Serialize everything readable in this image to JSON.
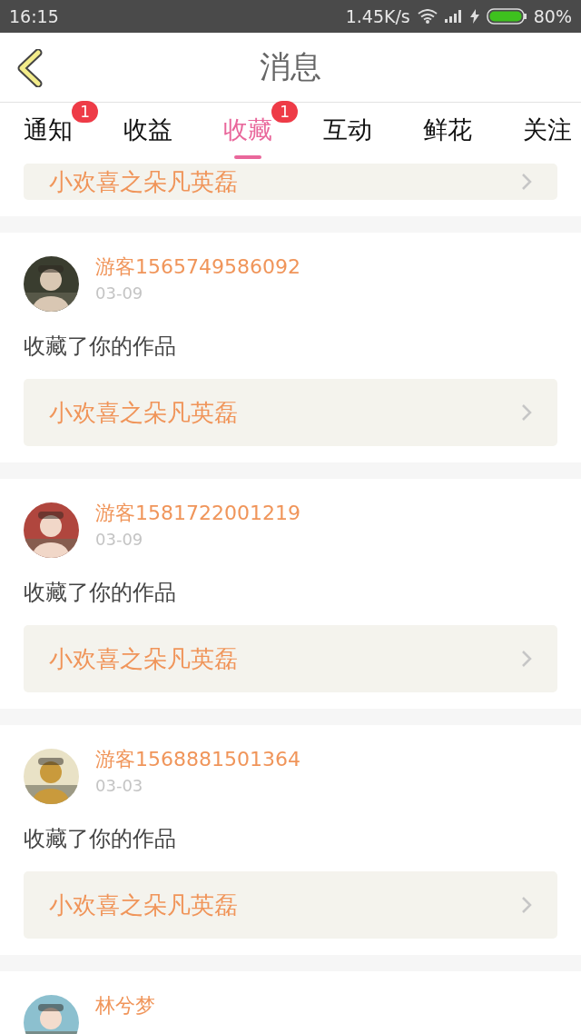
{
  "status_bar": {
    "time": "16:15",
    "speed": "1.45K/s",
    "battery": "80%"
  },
  "header": {
    "title": "消息"
  },
  "tabs": [
    {
      "label": "通知",
      "selected": false,
      "badge": "1"
    },
    {
      "label": "收益",
      "selected": false
    },
    {
      "label": "收藏",
      "selected": true,
      "badge": "1"
    },
    {
      "label": "互动",
      "selected": false
    },
    {
      "label": "鲜花",
      "selected": false
    },
    {
      "label": "关注",
      "selected": false
    }
  ],
  "partial_item": {
    "work": "小欢喜之朵凡英磊"
  },
  "items": [
    {
      "user": "游客1565749586092",
      "date": "03-09",
      "action": "收藏了你的作品",
      "work": "小欢喜之朵凡英磊"
    },
    {
      "user": "游客1581722001219",
      "date": "03-09",
      "action": "收藏了你的作品",
      "work": "小欢喜之朵凡英磊"
    },
    {
      "user": "游客1568881501364",
      "date": "03-03",
      "action": "收藏了你的作品",
      "work": "小欢喜之朵凡英磊"
    },
    {
      "user": "林兮梦"
    }
  ]
}
